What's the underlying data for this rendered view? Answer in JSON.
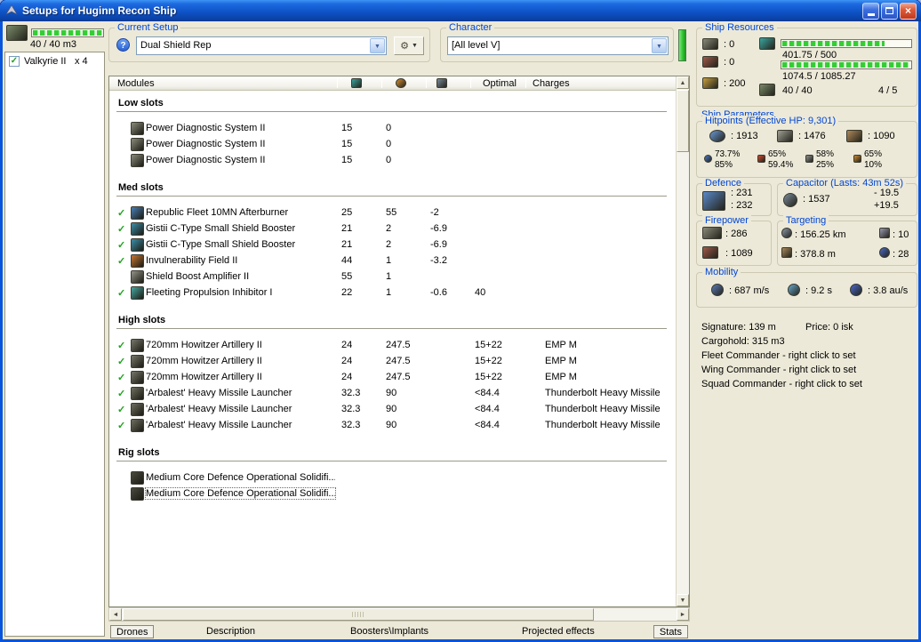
{
  "colors": {
    "accent_green": "#3BD33B",
    "group_title_blue": "#0046D5",
    "active_check_green": "#1FA31F",
    "titlebar_blue": "#0F53C8",
    "close_button_red": "#DD5B3A"
  },
  "icons": {
    "help": "?",
    "tools": "⚙",
    "dropdown": "▼",
    "check": "✓",
    "up": "▲",
    "down": "▼",
    "left": "◄",
    "right": "►",
    "close": "×"
  },
  "window": {
    "title": "Setups for Huginn Recon Ship"
  },
  "drones_panel": {
    "capacity_text": "40 / 40 m3",
    "fill_pct": 100,
    "items": [
      {
        "checked": true,
        "name": "Valkyrie II",
        "qty": "x 4"
      }
    ]
  },
  "setup_bar": {
    "current_setup_label": "Current Setup",
    "current_setup_value": "Dual Shield Rep",
    "character_label": "Character",
    "character_value": "[All level V]"
  },
  "modules_table": {
    "headers": {
      "modules": "Modules",
      "optimal": "Optimal",
      "charges": "Charges"
    },
    "sections": [
      {
        "name": "Low slots",
        "rows": [
          {
            "active": false,
            "icon": {
              "name": "power-diagnostic-icon",
              "color": "#8C8C7C"
            },
            "name": "Power Diagnostic System II",
            "cpu": "15",
            "pg": "0",
            "cap": "",
            "optimal": "",
            "charges": ""
          },
          {
            "active": false,
            "icon": {
              "name": "power-diagnostic-icon",
              "color": "#8C8C7C"
            },
            "name": "Power Diagnostic System II",
            "cpu": "15",
            "pg": "0",
            "cap": "",
            "optimal": "",
            "charges": ""
          },
          {
            "active": false,
            "icon": {
              "name": "power-diagnostic-icon",
              "color": "#8C8C7C"
            },
            "name": "Power Diagnostic System II",
            "cpu": "15",
            "pg": "0",
            "cap": "",
            "optimal": "",
            "charges": ""
          }
        ]
      },
      {
        "name": "Med slots",
        "rows": [
          {
            "active": true,
            "icon": {
              "name": "afterburner-icon",
              "color": "#4A7FB5"
            },
            "name": "Republic Fleet 10MN Afterburner",
            "cpu": "25",
            "pg": "55",
            "cap": "-2",
            "optimal": "",
            "charges": ""
          },
          {
            "active": true,
            "icon": {
              "name": "shield-booster-icon",
              "color": "#3E8FA8"
            },
            "name": "Gistii C-Type Small Shield Booster",
            "cpu": "21",
            "pg": "2",
            "cap": "-6.9",
            "optimal": "",
            "charges": ""
          },
          {
            "active": true,
            "icon": {
              "name": "shield-booster-icon",
              "color": "#3E8FA8"
            },
            "name": "Gistii C-Type Small Shield Booster",
            "cpu": "21",
            "pg": "2",
            "cap": "-6.9",
            "optimal": "",
            "charges": ""
          },
          {
            "active": true,
            "icon": {
              "name": "invulnerability-field-icon",
              "color": "#C87832"
            },
            "name": "Invulnerability Field II",
            "cpu": "44",
            "pg": "1",
            "cap": "-3.2",
            "optimal": "",
            "charges": ""
          },
          {
            "active": false,
            "icon": {
              "name": "shield-boost-amplifier-icon",
              "color": "#95958A"
            },
            "name": "Shield Boost Amplifier II",
            "cpu": "55",
            "pg": "1",
            "cap": "",
            "optimal": "",
            "charges": ""
          },
          {
            "active": true,
            "icon": {
              "name": "stasis-webifier-icon",
              "color": "#49A8A0"
            },
            "name": "Fleeting Propulsion Inhibitor I",
            "cpu": "22",
            "pg": "1",
            "cap": "-0.6",
            "optimal": "40",
            "charges": ""
          }
        ]
      },
      {
        "name": "High slots",
        "rows": [
          {
            "active": true,
            "icon": {
              "name": "artillery-turret-icon",
              "color": "#77776A"
            },
            "name": "720mm Howitzer Artillery II",
            "cpu": "24",
            "pg": "247.5",
            "cap": "",
            "optimal": "15+22",
            "charges": "EMP M"
          },
          {
            "active": true,
            "icon": {
              "name": "artillery-turret-icon",
              "color": "#77776A"
            },
            "name": "720mm Howitzer Artillery II",
            "cpu": "24",
            "pg": "247.5",
            "cap": "",
            "optimal": "15+22",
            "charges": "EMP M"
          },
          {
            "active": true,
            "icon": {
              "name": "artillery-turret-icon",
              "color": "#77776A"
            },
            "name": "720mm Howitzer Artillery II",
            "cpu": "24",
            "pg": "247.5",
            "cap": "",
            "optimal": "15+22",
            "charges": "EMP M"
          },
          {
            "active": true,
            "icon": {
              "name": "missile-launcher-icon",
              "color": "#6E6E60"
            },
            "name": "'Arbalest' Heavy Missile Launcher",
            "cpu": "32.3",
            "pg": "90",
            "cap": "",
            "optimal": "<84.4",
            "charges": "Thunderbolt Heavy Missile"
          },
          {
            "active": true,
            "icon": {
              "name": "missile-launcher-icon",
              "color": "#6E6E60"
            },
            "name": "'Arbalest' Heavy Missile Launcher",
            "cpu": "32.3",
            "pg": "90",
            "cap": "",
            "optimal": "<84.4",
            "charges": "Thunderbolt Heavy Missile"
          },
          {
            "active": true,
            "icon": {
              "name": "missile-launcher-icon",
              "color": "#6E6E60"
            },
            "name": "'Arbalest' Heavy Missile Launcher",
            "cpu": "32.3",
            "pg": "90",
            "cap": "",
            "optimal": "<84.4",
            "charges": "Thunderbolt Heavy Missile"
          }
        ]
      },
      {
        "name": "Rig slots",
        "rows": [
          {
            "active": false,
            "icon": {
              "name": "rig-icon",
              "color": "#4A4A40"
            },
            "name": "Medium Core Defence Operational Solidifi...",
            "cpu": "",
            "pg": "",
            "cap": "",
            "optimal": "",
            "charges": ""
          },
          {
            "active": false,
            "selected": true,
            "icon": {
              "name": "rig-icon",
              "color": "#4A4A40"
            },
            "name": "Medium Core Defence Operational Solidifi...",
            "cpu": "",
            "pg": "",
            "cap": "",
            "optimal": "",
            "charges": ""
          }
        ]
      }
    ]
  },
  "bottom_tabs": [
    {
      "label": "Drones",
      "boxed": true
    },
    {
      "label": "Description",
      "boxed": false
    },
    {
      "label": "Boosters\\Implants",
      "boxed": false
    },
    {
      "label": "Projected effects",
      "boxed": false
    },
    {
      "label": "Stats",
      "boxed": true
    }
  ],
  "ship_resources": {
    "title": "Ship Resources",
    "turrets_free": ": 0",
    "launchers_free": ": 0",
    "calibration": ": 200",
    "cpu_text": "401.75 / 500",
    "cpu_fill_pct": 80,
    "powergrid_text": "1074.5 / 1085.27",
    "powergrid_fill_pct": 99,
    "dronebay_text": "40 / 40",
    "hardpoints_text": "4 / 5"
  },
  "ship_parameters": {
    "title": "Ship Parameters",
    "hitpoints": {
      "title": "Hitpoints (Effective HP: 9,301)",
      "shield": ": 1913",
      "armor": ": 1476",
      "structure": ": 1090",
      "resists": [
        {
          "top": "73.7%",
          "bottom": "85%"
        },
        {
          "top": "65%",
          "bottom": "59.4%"
        },
        {
          "top": "58%",
          "bottom": "25%"
        },
        {
          "top": "65%",
          "bottom": "10%"
        }
      ]
    },
    "defence": {
      "title": "Defence",
      "top": ": 231",
      "bottom": ": 232"
    },
    "capacitor": {
      "title": "Capacitor (Lasts: 43m 52s)",
      "amount": ": 1537",
      "drain": "- 19.5",
      "recharge": "+19.5"
    },
    "firepower": {
      "title": "Firepower",
      "dps": ": 286",
      "volley": ": 1089"
    },
    "targeting": {
      "title": "Targeting",
      "range": ": 156.25 km",
      "max_targets": ": 10",
      "scan_res": ": 378.8 m",
      "sensor_strength": ": 28"
    },
    "mobility": {
      "title": "Mobility",
      "speed": ": 687 m/s",
      "align": ": 9.2 s",
      "warp": ": 3.8 au/s"
    }
  },
  "info": {
    "signature": "Signature: 139 m",
    "price": "Price: 0 isk",
    "cargohold": "Cargohold: 315 m3",
    "fleet_commander": "Fleet Commander - right click to set",
    "wing_commander": "Wing Commander - right click to set",
    "squad_commander": "Squad Commander - right click to set"
  }
}
